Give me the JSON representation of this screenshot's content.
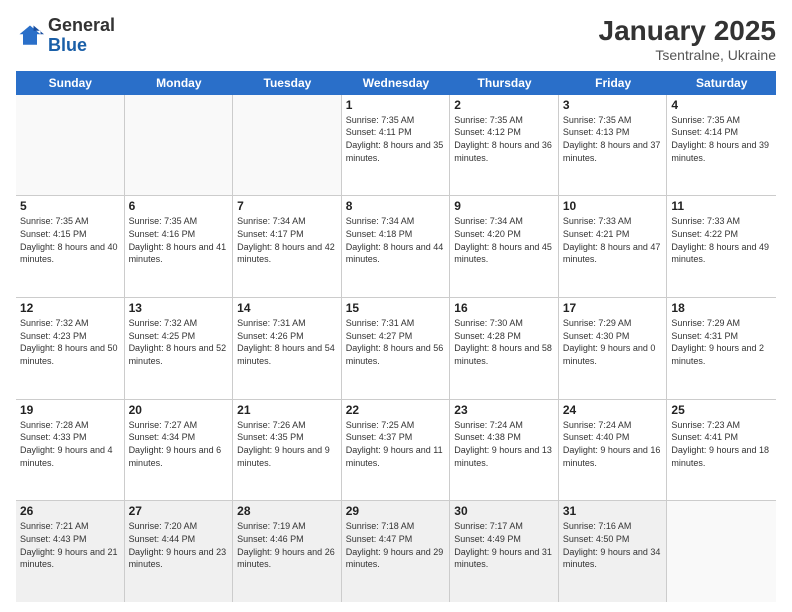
{
  "logo": {
    "general": "General",
    "blue": "Blue"
  },
  "title": "January 2025",
  "subtitle": "Tsentralne, Ukraine",
  "header": {
    "days": [
      "Sunday",
      "Monday",
      "Tuesday",
      "Wednesday",
      "Thursday",
      "Friday",
      "Saturday"
    ]
  },
  "weeks": [
    [
      {
        "day": "",
        "info": "",
        "empty": true
      },
      {
        "day": "",
        "info": "",
        "empty": true
      },
      {
        "day": "",
        "info": "",
        "empty": true
      },
      {
        "day": "1",
        "info": "Sunrise: 7:35 AM\nSunset: 4:11 PM\nDaylight: 8 hours and 35 minutes."
      },
      {
        "day": "2",
        "info": "Sunrise: 7:35 AM\nSunset: 4:12 PM\nDaylight: 8 hours and 36 minutes."
      },
      {
        "day": "3",
        "info": "Sunrise: 7:35 AM\nSunset: 4:13 PM\nDaylight: 8 hours and 37 minutes."
      },
      {
        "day": "4",
        "info": "Sunrise: 7:35 AM\nSunset: 4:14 PM\nDaylight: 8 hours and 39 minutes."
      }
    ],
    [
      {
        "day": "5",
        "info": "Sunrise: 7:35 AM\nSunset: 4:15 PM\nDaylight: 8 hours and 40 minutes."
      },
      {
        "day": "6",
        "info": "Sunrise: 7:35 AM\nSunset: 4:16 PM\nDaylight: 8 hours and 41 minutes."
      },
      {
        "day": "7",
        "info": "Sunrise: 7:34 AM\nSunset: 4:17 PM\nDaylight: 8 hours and 42 minutes."
      },
      {
        "day": "8",
        "info": "Sunrise: 7:34 AM\nSunset: 4:18 PM\nDaylight: 8 hours and 44 minutes."
      },
      {
        "day": "9",
        "info": "Sunrise: 7:34 AM\nSunset: 4:20 PM\nDaylight: 8 hours and 45 minutes."
      },
      {
        "day": "10",
        "info": "Sunrise: 7:33 AM\nSunset: 4:21 PM\nDaylight: 8 hours and 47 minutes."
      },
      {
        "day": "11",
        "info": "Sunrise: 7:33 AM\nSunset: 4:22 PM\nDaylight: 8 hours and 49 minutes."
      }
    ],
    [
      {
        "day": "12",
        "info": "Sunrise: 7:32 AM\nSunset: 4:23 PM\nDaylight: 8 hours and 50 minutes."
      },
      {
        "day": "13",
        "info": "Sunrise: 7:32 AM\nSunset: 4:25 PM\nDaylight: 8 hours and 52 minutes."
      },
      {
        "day": "14",
        "info": "Sunrise: 7:31 AM\nSunset: 4:26 PM\nDaylight: 8 hours and 54 minutes."
      },
      {
        "day": "15",
        "info": "Sunrise: 7:31 AM\nSunset: 4:27 PM\nDaylight: 8 hours and 56 minutes."
      },
      {
        "day": "16",
        "info": "Sunrise: 7:30 AM\nSunset: 4:28 PM\nDaylight: 8 hours and 58 minutes."
      },
      {
        "day": "17",
        "info": "Sunrise: 7:29 AM\nSunset: 4:30 PM\nDaylight: 9 hours and 0 minutes."
      },
      {
        "day": "18",
        "info": "Sunrise: 7:29 AM\nSunset: 4:31 PM\nDaylight: 9 hours and 2 minutes."
      }
    ],
    [
      {
        "day": "19",
        "info": "Sunrise: 7:28 AM\nSunset: 4:33 PM\nDaylight: 9 hours and 4 minutes."
      },
      {
        "day": "20",
        "info": "Sunrise: 7:27 AM\nSunset: 4:34 PM\nDaylight: 9 hours and 6 minutes."
      },
      {
        "day": "21",
        "info": "Sunrise: 7:26 AM\nSunset: 4:35 PM\nDaylight: 9 hours and 9 minutes."
      },
      {
        "day": "22",
        "info": "Sunrise: 7:25 AM\nSunset: 4:37 PM\nDaylight: 9 hours and 11 minutes."
      },
      {
        "day": "23",
        "info": "Sunrise: 7:24 AM\nSunset: 4:38 PM\nDaylight: 9 hours and 13 minutes."
      },
      {
        "day": "24",
        "info": "Sunrise: 7:24 AM\nSunset: 4:40 PM\nDaylight: 9 hours and 16 minutes."
      },
      {
        "day": "25",
        "info": "Sunrise: 7:23 AM\nSunset: 4:41 PM\nDaylight: 9 hours and 18 minutes."
      }
    ],
    [
      {
        "day": "26",
        "info": "Sunrise: 7:21 AM\nSunset: 4:43 PM\nDaylight: 9 hours and 21 minutes.",
        "shaded": true
      },
      {
        "day": "27",
        "info": "Sunrise: 7:20 AM\nSunset: 4:44 PM\nDaylight: 9 hours and 23 minutes.",
        "shaded": true
      },
      {
        "day": "28",
        "info": "Sunrise: 7:19 AM\nSunset: 4:46 PM\nDaylight: 9 hours and 26 minutes.",
        "shaded": true
      },
      {
        "day": "29",
        "info": "Sunrise: 7:18 AM\nSunset: 4:47 PM\nDaylight: 9 hours and 29 minutes.",
        "shaded": true
      },
      {
        "day": "30",
        "info": "Sunrise: 7:17 AM\nSunset: 4:49 PM\nDaylight: 9 hours and 31 minutes.",
        "shaded": true
      },
      {
        "day": "31",
        "info": "Sunrise: 7:16 AM\nSunset: 4:50 PM\nDaylight: 9 hours and 34 minutes.",
        "shaded": true
      },
      {
        "day": "",
        "info": "",
        "empty": true,
        "shaded": true
      }
    ]
  ]
}
